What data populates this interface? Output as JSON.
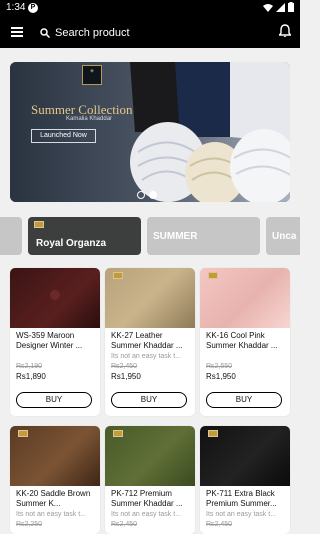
{
  "status_bar": {
    "time": "1:34",
    "app_badge": "P"
  },
  "app_bar": {
    "search_label": "Search product"
  },
  "hero": {
    "logo_text": "Kamalia Khaddar",
    "collection_title": "Summer Collection",
    "collection_subtitle": "Kamalia Khaddar",
    "cta": "Launched Now",
    "slides": 2,
    "active_slide": 2
  },
  "categories": [
    "Royal Organza",
    "SUMMER",
    "Unca"
  ],
  "products": [
    {
      "name": "WS-359 Maroon Designer Winter ...",
      "tagline": "",
      "old_price": "Rs2,190",
      "price": "Rs1,890",
      "buy_label": "BUY"
    },
    {
      "name": "KK-27 Leather Summer Khaddar ...",
      "tagline": "Its not an easy task t...",
      "old_price": "Rs2,450",
      "price": "Rs1,950",
      "buy_label": "BUY"
    },
    {
      "name": "KK-16 Cool Pink Summer Khaddar ...",
      "tagline": "",
      "old_price": "Rs2,550",
      "price": "Rs1,950",
      "buy_label": "BUY"
    },
    {
      "name": "KK-20 Saddle Brown Summer K...",
      "tagline": "Its not an easy task t...",
      "old_price": "Rs2,250",
      "price": "",
      "buy_label": ""
    },
    {
      "name": "PK-712 Premium Summer Khaddar ...",
      "tagline": "Its not an easy task t...",
      "old_price": "Rs2,450",
      "price": "",
      "buy_label": ""
    },
    {
      "name": "PK-711 Extra Black Premium Summer...",
      "tagline": "Its not an easy task t...",
      "old_price": "Rs2,450",
      "price": "",
      "buy_label": ""
    }
  ],
  "colors": {
    "bar_bg": "#000000",
    "page_bg": "#f0f0f0",
    "chip_bg": "#c6c6c6",
    "gold": "#e6c98b"
  }
}
